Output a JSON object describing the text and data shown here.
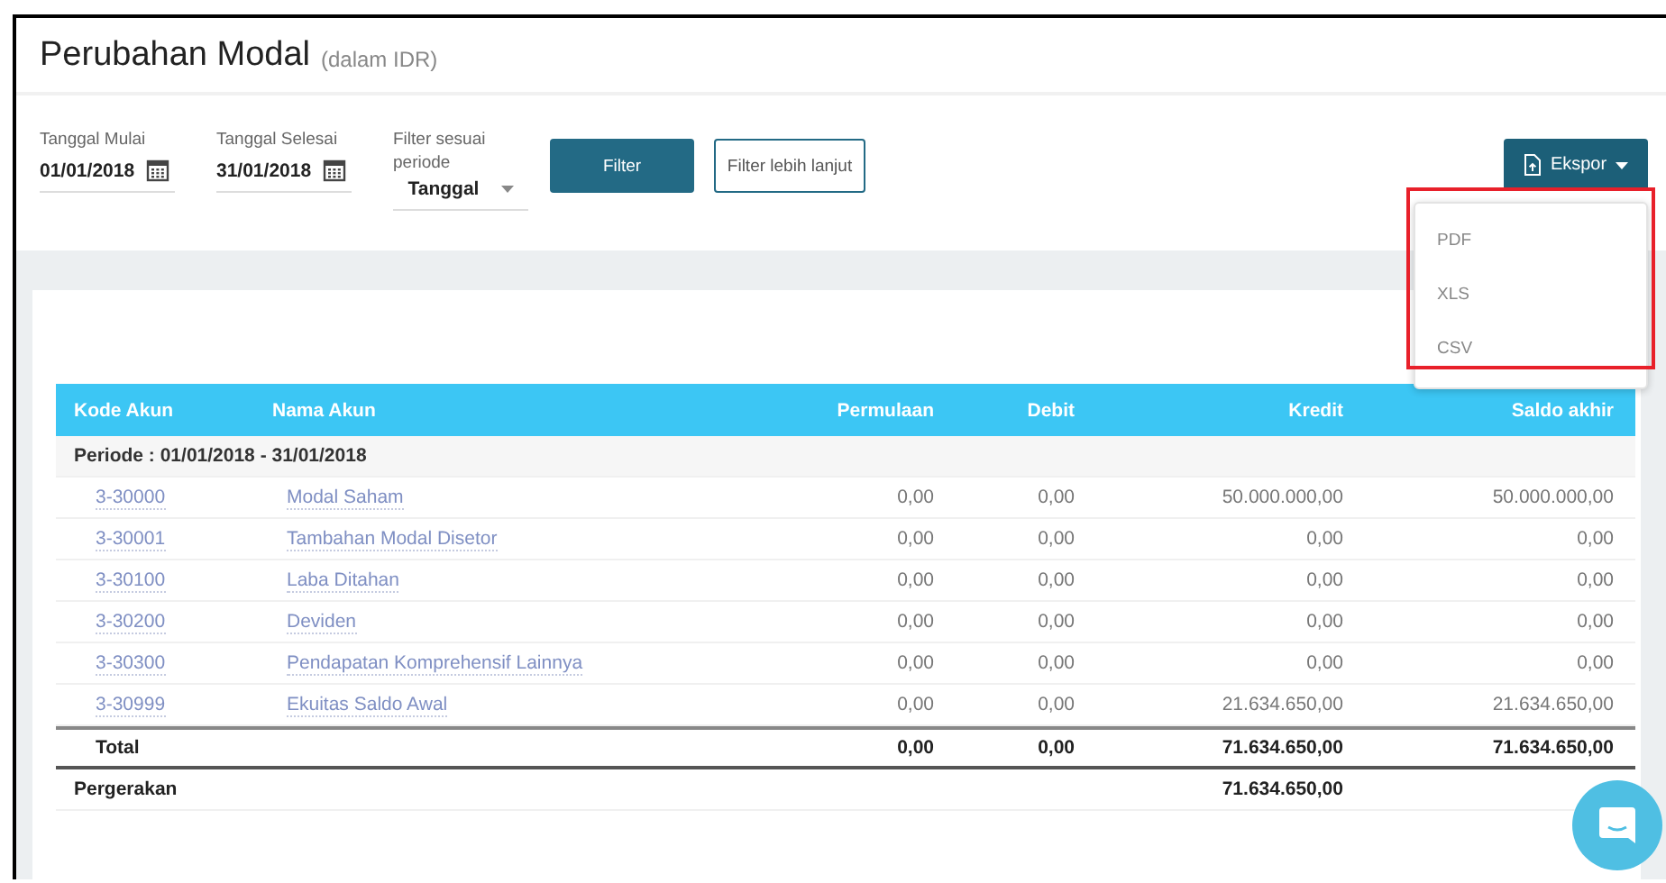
{
  "title": "Perubahan Modal",
  "subtitle": "(dalam IDR)",
  "filters": [
    {
      "kind": "date",
      "label": "Tanggal Mulai",
      "value": "01/01/2018"
    },
    {
      "kind": "date",
      "label": "Tanggal Selesai",
      "value": "31/01/2018"
    },
    {
      "kind": "select",
      "label": "Filter sesuai periode",
      "value": "Tanggal"
    }
  ],
  "filter_button": "Filter",
  "advanced_filter_button": "Filter lebih lanjut",
  "export_button": {
    "label": "Ekspor",
    "expanded": true
  },
  "export_menu": [
    "PDF",
    "XLS",
    "CSV"
  ],
  "table": {
    "columns": [
      "Kode Akun",
      "Nama Akun",
      "Permulaan",
      "Debit",
      "Kredit",
      "Saldo akhir"
    ],
    "period": "Periode : 01/01/2018 - 31/01/2018",
    "rows": [
      {
        "code": "3-30000",
        "name": "Modal Saham",
        "values": [
          "0,00",
          "0,00",
          "50.000.000,00",
          "50.000.000,00"
        ]
      },
      {
        "code": "3-30001",
        "name": "Tambahan Modal Disetor",
        "values": [
          "0,00",
          "0,00",
          "0,00",
          "0,00"
        ]
      },
      {
        "code": "3-30100",
        "name": "Laba Ditahan",
        "values": [
          "0,00",
          "0,00",
          "0,00",
          "0,00"
        ]
      },
      {
        "code": "3-30200",
        "name": "Deviden",
        "values": [
          "0,00",
          "0,00",
          "0,00",
          "0,00"
        ]
      },
      {
        "code": "3-30300",
        "name": "Pendapatan Komprehensif Lainnya",
        "values": [
          "0,00",
          "0,00",
          "0,00",
          "0,00"
        ]
      },
      {
        "code": "3-30999",
        "name": "Ekuitas Saldo Awal",
        "values": [
          "0,00",
          "0,00",
          "21.634.650,00",
          "21.634.650,00"
        ]
      }
    ],
    "total": {
      "label": "Total",
      "values": [
        "0,00",
        "0,00",
        "71.634.650,00",
        "71.634.650,00"
      ]
    },
    "movement": {
      "label": "Pergerakan",
      "credit": "71.634.650,00"
    }
  }
}
